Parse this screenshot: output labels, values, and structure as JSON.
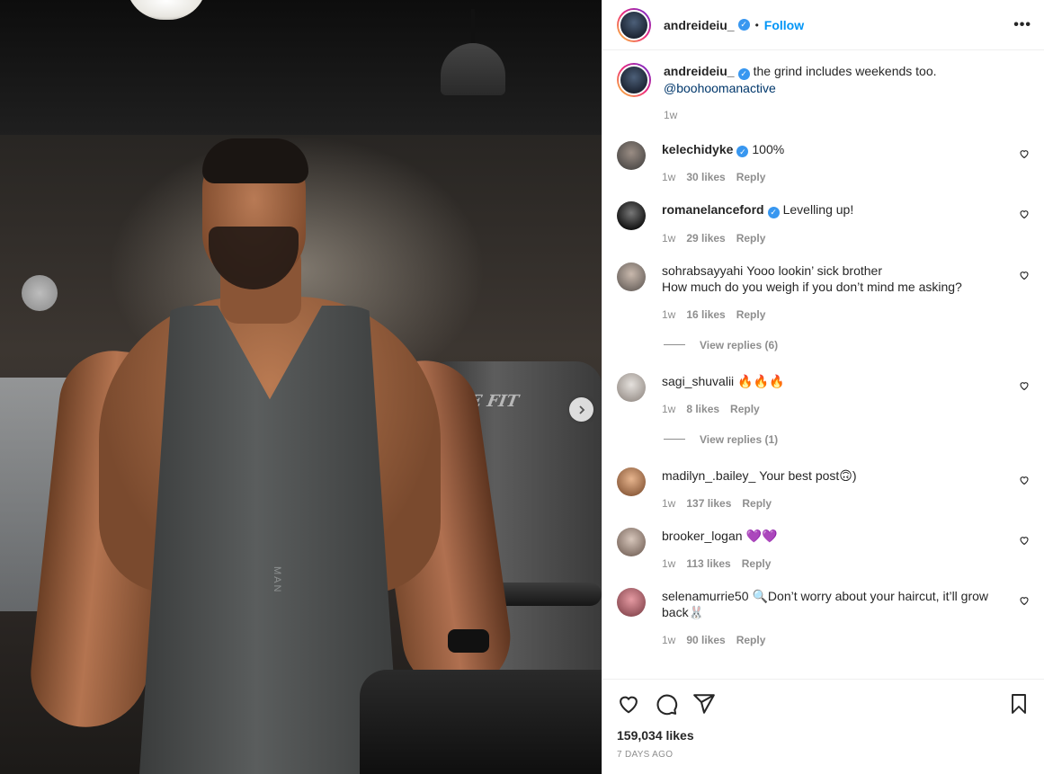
{
  "post": {
    "author": "andreideiu_",
    "follow_label": "Follow",
    "dot": "•",
    "more": "•••",
    "caption": "the grind includes weekends too.",
    "caption_mention": "@boohoomanactive",
    "caption_time": "1w",
    "likes": "159,034 likes",
    "time_ago": "7 DAYS AGO"
  },
  "photo": {
    "tank_logo": "MAN",
    "machine_label": "LIFE FIT"
  },
  "comments": [
    {
      "user": "kelechidyke",
      "verified": true,
      "text": "100%",
      "time": "1w",
      "likes": "30 likes",
      "reply": "Reply",
      "avatar_color": "#6b6b6b"
    },
    {
      "user": "romanelanceford",
      "verified": true,
      "text": "Levelling up!",
      "time": "1w",
      "likes": "29 likes",
      "reply": "Reply",
      "avatar_color": "#2a2a2a"
    },
    {
      "user": "sohrabsayyahi",
      "verified": false,
      "text": "Yooo lookin’ sick brother",
      "text2": "How much do you weigh if you don’t mind me asking?",
      "time": "1w",
      "likes": "16 likes",
      "reply": "Reply",
      "view_replies": "View replies (6)",
      "avatar_color": "#8a8a8a"
    },
    {
      "user": "sagi_shuvalii",
      "verified": false,
      "text": "🔥🔥🔥",
      "time": "1w",
      "likes": "8 likes",
      "reply": "Reply",
      "view_replies": "View replies (1)",
      "avatar_color": "#b9b2ad"
    },
    {
      "user": "madilyn_.bailey_",
      "verified": false,
      "text": "Your best post🙃)",
      "time": "1w",
      "likes": "137 likes",
      "reply": "Reply",
      "avatar_color": "#c98f66"
    },
    {
      "user": "brooker_logan",
      "verified": false,
      "text": "💜💜",
      "time": "1w",
      "likes": "113 likes",
      "reply": "Reply",
      "avatar_color": "#a88f82"
    },
    {
      "user": "selenamurrie50",
      "verified": false,
      "text": "🔍Don’t worry about your haircut, it’ll grow back🐰",
      "time": "1w",
      "likes": "90 likes",
      "reply": "Reply",
      "avatar_color": "#c4737a"
    }
  ],
  "colors": {
    "link": "#0095f6",
    "verified": "#3897f0",
    "muted": "#8e8e8e"
  },
  "icons": {
    "like": "heart-icon",
    "comment": "comment-icon",
    "share": "paper-plane-icon",
    "save": "bookmark-icon",
    "next": "chevron-right-icon"
  }
}
